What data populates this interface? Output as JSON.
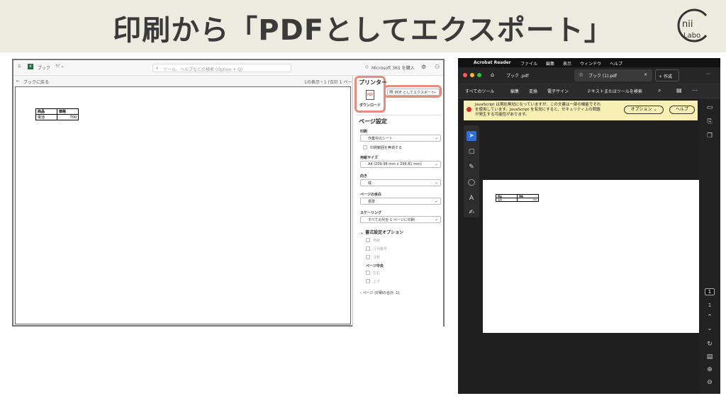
{
  "banner": {
    "title": "印刷から「PDFとしてエクスポート」"
  },
  "logo": {
    "text": "Labo",
    "initials": "nii"
  },
  "excel": {
    "app_name": "ブック",
    "search_placeholder": "ツール、ヘルプなどの検索 (Option + Q)",
    "m365_label": "Microsoft 365 を購入",
    "back_label": "ブックに戻る",
    "page_count": "1の表示・1 (合計 1 ページ)",
    "table": [
      [
        "商品",
        "価格"
      ],
      [
        "電池",
        "700"
      ]
    ],
    "panel": {
      "printer_heading": "プリンター",
      "download_label": "ダウンロード",
      "pdf_icon_label": "PDF",
      "printer_value": "PDF としてエクスポート",
      "page_setup_heading": "ページ設定",
      "print_label": "印刷",
      "print_value": "作業中のシート",
      "ignore_area_label": "印刷範囲を無視する",
      "paper_label": "用紙サイズ",
      "paper_value": "A4 (209.98 mm x 296.81 mm)",
      "orientation_label": "向き",
      "orientation_value": "縦",
      "margins_label": "ページの余白",
      "margins_value": "標準",
      "scaling_label": "スケーリング",
      "scaling_value": "すべての列を 1 ページに印刷",
      "format_options_heading": "書式設定オプション",
      "gridlines": "枠線",
      "headings": "行列番号",
      "comments": "注釈",
      "page_center_label": "ページ中央",
      "horizontal": "左右",
      "vertical": "上下",
      "pages_label": "ページ (印刷の合計: 1)"
    }
  },
  "acrobat": {
    "menu": [
      "Acrobat Reader",
      "ファイル",
      "編集",
      "表示",
      "ウィンドウ",
      "ヘルプ"
    ],
    "tab1": "ブック .pdf",
    "tab2": "ブック (1).pdf",
    "create_label": "作成",
    "tools": [
      "すべてのツール",
      "編集",
      "変換",
      "電子サイン"
    ],
    "search_label": "テキストまたはツールを検索",
    "warning_text": "JavaScript は現在無効になっていますが、この文書は一部の機能でそれを使用しています。JavaScript を有効にすると、セキュリティ上の問題が発生する可能性があります。",
    "options_label": "オプション",
    "help_label": "ヘルプ",
    "page_current": "1",
    "page_total": "1",
    "table": [
      [
        "商品",
        "価格"
      ],
      [
        "電池",
        "700"
      ]
    ]
  }
}
